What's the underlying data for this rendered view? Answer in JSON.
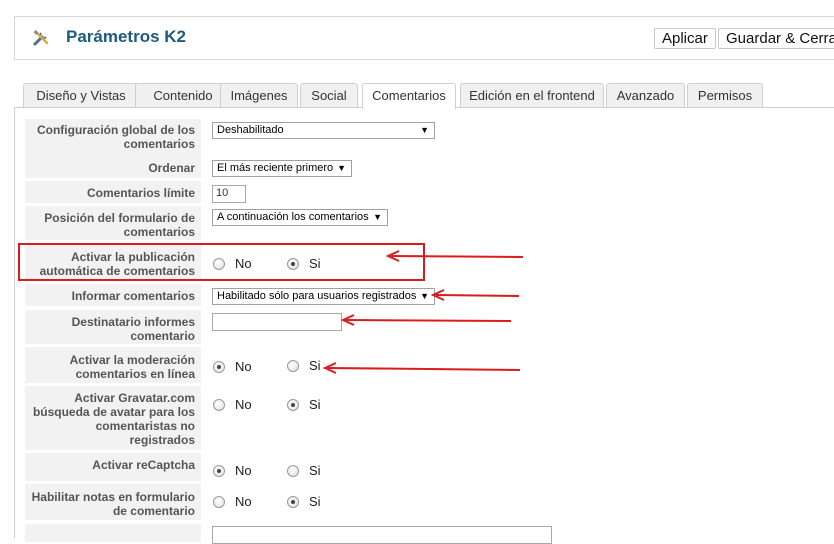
{
  "header": {
    "title": "Parámetros K2",
    "apply_label": "Aplicar",
    "save_close_label": "Guardar & Cerrar",
    "icon": "tools-icon"
  },
  "tabs": [
    {
      "label": "Diseño y Vistas",
      "active": false
    },
    {
      "label": "Contenido",
      "active": false
    },
    {
      "label": "Imágenes",
      "active": false
    },
    {
      "label": "Social",
      "active": false
    },
    {
      "label": "Comentarios",
      "active": true
    },
    {
      "label": "Edición en el frontend",
      "active": false
    },
    {
      "label": "Avanzado",
      "active": false
    },
    {
      "label": "Permisos",
      "active": false
    }
  ],
  "form": {
    "global_comments": {
      "label": "Configuración global de los comentarios",
      "value": "Deshabilitado"
    },
    "order": {
      "label": "Ordenar",
      "value": "El más reciente primero"
    },
    "comments_limit": {
      "label": "Comentarios límite",
      "value": "10"
    },
    "form_position": {
      "label": "Posición del formulario de comentarios",
      "value": "A continuación los comentarios"
    },
    "auto_publish": {
      "label": "Activar la publicación automática de comentarios",
      "no": "No",
      "yes": "Si",
      "selected": "yes"
    },
    "report_comments": {
      "label": "Informar comentarios",
      "value": "Habilitado sólo para usuarios registrados"
    },
    "report_recipient": {
      "label": "Destinatario informes comentario",
      "value": ""
    },
    "online_moderation": {
      "label": "Activar la moderación comentarios en línea",
      "no": "No",
      "yes": "Si",
      "selected": "no"
    },
    "gravatar": {
      "label": "Activar Gravatar.com búsqueda de avatar para los comentaristas no registrados",
      "no": "No",
      "yes": "Si",
      "selected": "yes"
    },
    "recaptcha": {
      "label": "Activar reCaptcha",
      "no": "No",
      "yes": "Si",
      "selected": "no"
    },
    "form_notes": {
      "label": "Habilitar notas en formulario de comentario",
      "no": "No",
      "yes": "Si",
      "selected": "yes"
    }
  },
  "annotation": {
    "color": "#d81d1d"
  }
}
